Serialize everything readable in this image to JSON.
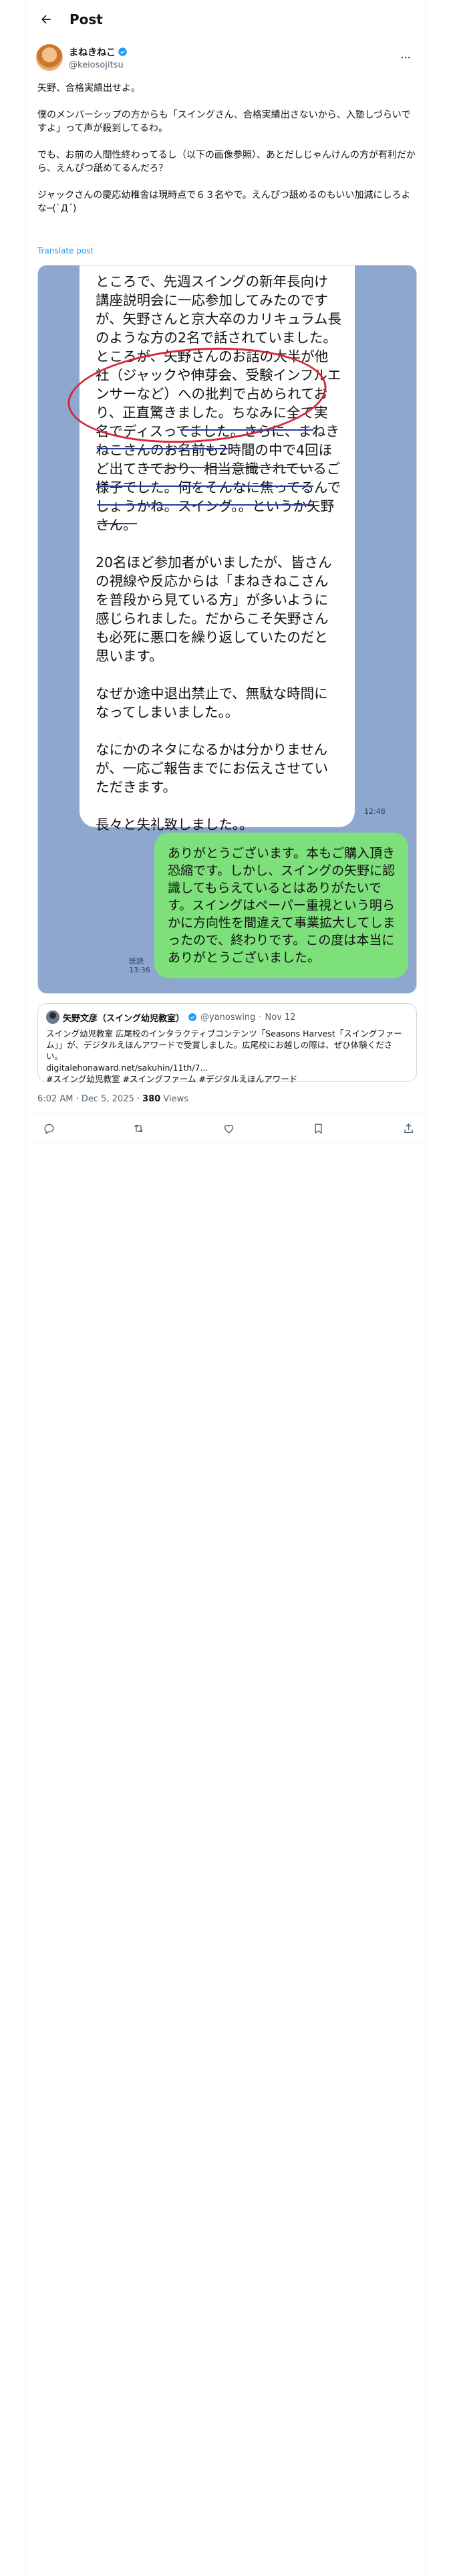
{
  "header": {
    "title": "Post"
  },
  "author": {
    "name": "まねきねこ",
    "handle": "@keiosojitsu"
  },
  "tweet": {
    "text": "矢野、合格実績出せよ。\n\n僕のメンバーシップの方からも「スイングさん、合格実績出さないから、入塾しづらいですよ」って声が殺到してるわ。\n\nでも、お前の人間性終わってるし（以下の画像参照）、あとだしじゃんけんの方が有利だから、えんぴつ舐めてるんだろ？\n\nジャックさんの慶応幼稚舎は現時点で６３名やで。えんぴつ舐めるのもいい加減にしろよな─(`Д´)",
    "translate_label": "Translate post"
  },
  "media": {
    "left_bubble_text": "ところで、先週スイングの新年長向け講座説明会に一応参加してみたのですが、矢野さんと京大卒のカリキュラム長のような方の2名で話されていました。ところが、矢野さんのお話の大半が他社（ジャックや伸芽会、受験インフルエンサーなど）への批判で占められており、正直驚きました。ちなみに全て実名でディスってました。さらに、まねきねこさんのお名前も2時間の中で4回ほど出てきており、相当意識されているご様子でした。何をそんなに焦ってるんでしょうかね。スイング。。というか矢野さん。\n\n20名ほど参加者がいましたが、皆さんの視線や反応からは「まねきねこさんを普段から見ている方」が多いように感じられました。だからこそ矢野さんも必死に悪口を繰り返していたのだと思います。\n\nなぜか途中退出禁止で、無駄な時間になってしまいました。。\n\nなにかのネタになるかは分かりませんが、一応ご報告までにお伝えさせていただきます。\n\n長々と失礼致しました。。",
    "left_time": "12:48",
    "right_bubble_text": "ありがとうございます。本もご購入頂き恐縮です。しかし、スイングの矢野に認識してもらえているとはありがたいです。スイングはペーパー重視という明らかに方向性を間違えて事業拡大してしまったので、終わりです。この度は本当にありがとうございました。",
    "read_label": "既読",
    "read_time": "13:36"
  },
  "quote": {
    "name": "矢野文彦（スイング幼児教室）",
    "handle": "@yanoswing",
    "date": "Nov 12",
    "text": "スイング幼児教室 広尾校のインタラクティブコンテンツ「Seasons Harvest「スイングファーム」」が、デジタルえほんアワードで受賞しました。広尾校にお越しの際は、ぜひ体験ください。\ndigitalehonaward.net/sakuhin/11th/7...\n#スイング幼児教室 #スイングファーム #デジタルえほんアワード"
  },
  "meta": {
    "time": "6:02 AM · Dec 5, 2025",
    "separator": " · ",
    "views_count": "380",
    "views_label": " Views"
  },
  "colors": {
    "accent": "#1d9bf0",
    "bubble_green": "#7de07a",
    "chat_bg": "#8ea7cf",
    "circle": "#d7283a"
  }
}
